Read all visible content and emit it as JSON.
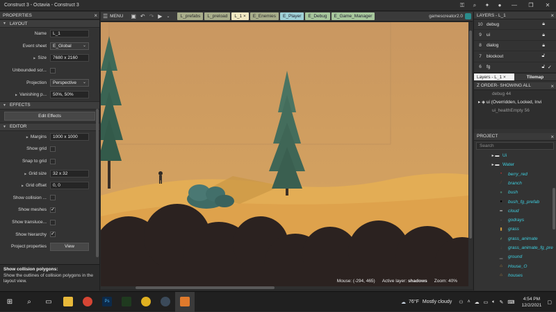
{
  "window": {
    "title": "Construct 3 - Octavia - Construct 3"
  },
  "properties": {
    "header": "PROPERTIES",
    "sections": {
      "layout": "LAYOUT",
      "effects": "EFFECTS",
      "editor": "EDITOR"
    },
    "layout": {
      "name_label": "Name",
      "name_value": "L_1",
      "event_sheet_label": "Event sheet",
      "event_sheet_value": "E_Global",
      "size_label": "Size",
      "size_value": "7680 x 2160",
      "unbounded_label": "Unbounded scr...",
      "projection_label": "Projection",
      "projection_value": "Perspective",
      "vanishing_label": "Vanishing p...",
      "vanishing_value": "50%, 50%"
    },
    "effects_button": "Edit Effects",
    "editor": {
      "margins_label": "Margins",
      "margins_value": "1000 x 1000",
      "show_grid_label": "Show grid",
      "snap_grid_label": "Snap to grid",
      "grid_size_label": "Grid size",
      "grid_size_value": "32 x 32",
      "grid_offset_label": "Grid offset",
      "grid_offset_value": "0, 0",
      "show_collision_label": "Show collision ...",
      "show_meshes_label": "Show meshes",
      "show_translucent_label": "Show transluce...",
      "show_hierarchy_label": "Show hierarchy",
      "project_props_label": "Project properties",
      "view_button": "View"
    },
    "help": {
      "title": "Show collision polygons:",
      "desc": "Show the outlines of collision polygons in the layout view."
    }
  },
  "toolbar": {
    "menu": "MENU",
    "tabs": [
      "L_prefabs",
      "L_preload",
      "L_1",
      "E_Enemies",
      "E_Player",
      "E_Debug",
      "E_Game_Manager"
    ],
    "account": "gamescreator2.0"
  },
  "status": {
    "mouse": "Mouse: (-294, 465)",
    "active_layer_label": "Active layer:",
    "active_layer": "shadows",
    "zoom": "Zoom: 40%"
  },
  "layers": {
    "header": "LAYERS - L_1",
    "rows": [
      {
        "num": "10",
        "name": "debug"
      },
      {
        "num": "9",
        "name": "ui"
      },
      {
        "num": "8",
        "name": "dialog"
      },
      {
        "num": "7",
        "name": "blockout"
      },
      {
        "num": "6",
        "name": "fg"
      }
    ],
    "tab_active": "Layers - L_1",
    "tab_other": "Tilemap"
  },
  "zorder": {
    "header": "Z ORDER- SHOWING ALL",
    "rows": [
      "debug 44",
      "ui (Overridden, Locked, Invi",
      "ui_healthEmpty 56"
    ]
  },
  "project": {
    "header": "PROJECT",
    "search_placeholder": "Search",
    "items": [
      {
        "name": "Ui",
        "type": "folder"
      },
      {
        "name": "Water",
        "type": "folder"
      },
      {
        "name": "berry_red",
        "type": "item"
      },
      {
        "name": "branch",
        "type": "item"
      },
      {
        "name": "bush",
        "type": "item"
      },
      {
        "name": "bush_fg_prefab",
        "type": "item"
      },
      {
        "name": "cloud",
        "type": "item"
      },
      {
        "name": "godrays",
        "type": "item"
      },
      {
        "name": "grass",
        "type": "item"
      },
      {
        "name": "grass_animate",
        "type": "item"
      },
      {
        "name": "grass_animate_fg_pre",
        "type": "item"
      },
      {
        "name": "ground",
        "type": "item"
      },
      {
        "name": "House_O",
        "type": "item"
      },
      {
        "name": "houses",
        "type": "item"
      }
    ]
  },
  "taskbar": {
    "weather_temp": "76°F",
    "weather_text": "Mostly cloudy",
    "time": "4:54 PM",
    "date": "12/2/2021"
  }
}
